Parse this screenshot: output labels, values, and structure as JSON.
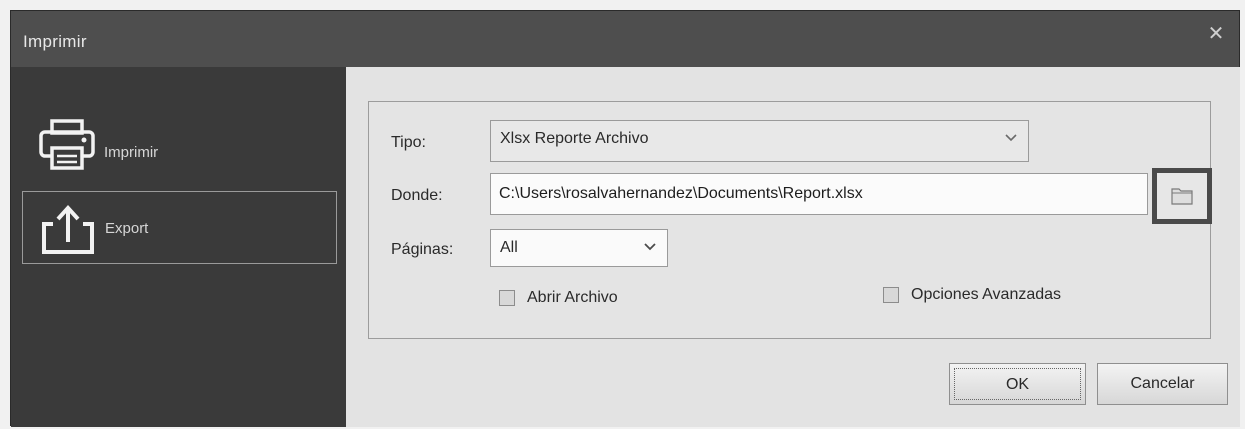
{
  "window": {
    "title": "Imprimir",
    "close_icon": "close-icon"
  },
  "sidebar": {
    "items": [
      {
        "label": "Imprimir",
        "icon": "printer-icon",
        "selected": false
      },
      {
        "label": "Export",
        "icon": "export-icon",
        "selected": true
      }
    ]
  },
  "form": {
    "tipo_label": "Tipo:",
    "tipo_value": "Xlsx Reporte Archivo",
    "donde_label": "Donde:",
    "donde_value": "C:\\Users\\rosalvahernandez\\Documents\\Report.xlsx",
    "browse_icon": "folder-icon",
    "paginas_label": "Páginas:",
    "paginas_value": "All",
    "abrir_archivo_label": "Abrir Archivo",
    "abrir_archivo_checked": false,
    "opciones_avanzadas_label": "Opciones Avanzadas",
    "opciones_avanzadas_checked": false
  },
  "buttons": {
    "ok_label": "OK",
    "cancel_label": "Cancelar"
  },
  "colors": {
    "titlebar": "#4e4e4e",
    "sidebar": "#3a3a3a",
    "content": "#e3e3e3",
    "browse_highlight": "#4a4a4a"
  }
}
